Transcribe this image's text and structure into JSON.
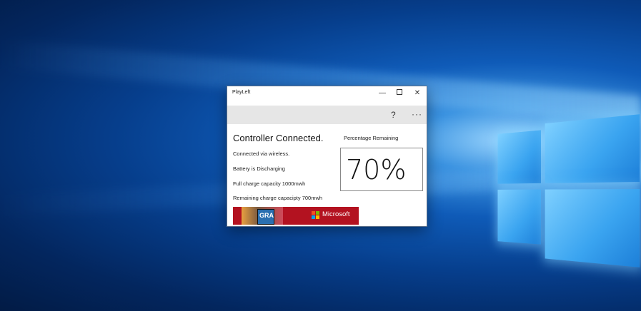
{
  "window": {
    "title": "PlayLeft",
    "minimize_glyph": "—",
    "close_glyph": "✕"
  },
  "commandbar": {
    "help_label": "?",
    "more_label": "···"
  },
  "status": {
    "heading": "Controller Connected.",
    "connection": "Connected via wireless.",
    "battery_state": "Battery is Discharging",
    "full_capacity": "Full charge capacity 1000mwh",
    "remaining_capacity": "Remaining charge capacipty 700mwh"
  },
  "percentage": {
    "label": "Percentage Remaining",
    "value": "70%"
  },
  "ad": {
    "brand": "Microsoft",
    "art_text": "GRA"
  },
  "colors": {
    "ad_background": "#b31220",
    "command_bar": "#e6e6e6",
    "desktop_blue": "#0f5bb8"
  }
}
